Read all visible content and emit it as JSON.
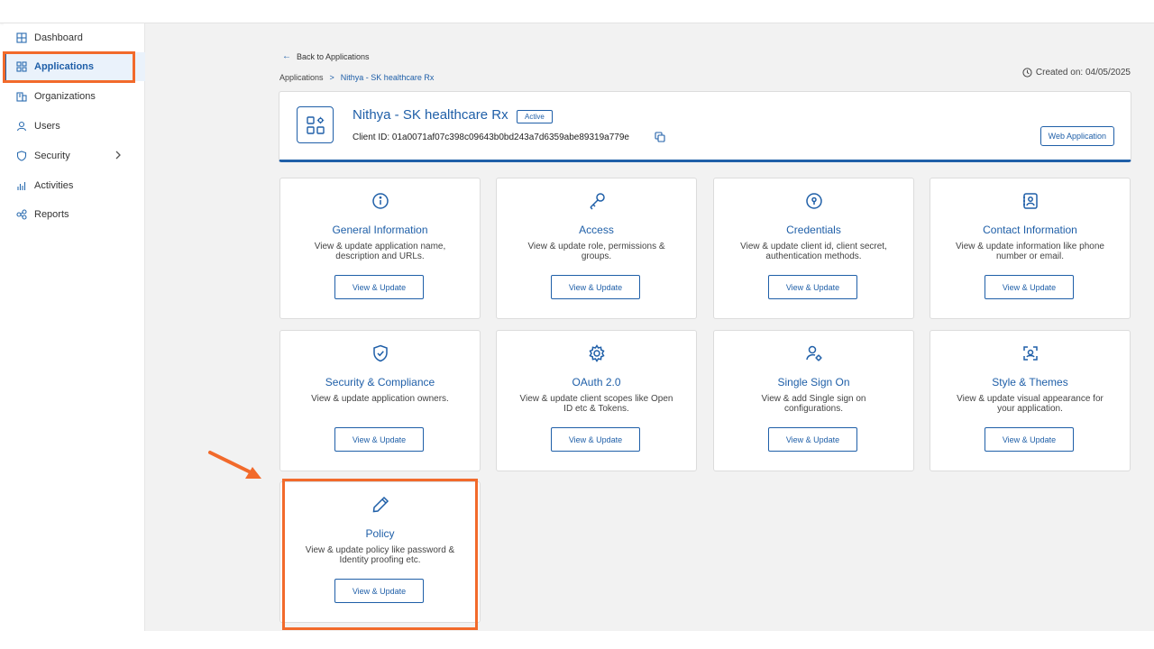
{
  "sidebar": {
    "items": [
      {
        "label": "Dashboard",
        "icon": "dashboard-icon"
      },
      {
        "label": "Applications",
        "icon": "applications-icon"
      },
      {
        "label": "Organizations",
        "icon": "organizations-icon"
      },
      {
        "label": "Users",
        "icon": "user-icon"
      },
      {
        "label": "Security",
        "icon": "shield-icon"
      },
      {
        "label": "Activities",
        "icon": "bar-chart-icon"
      },
      {
        "label": "Reports",
        "icon": "reports-icon"
      }
    ]
  },
  "nav": {
    "back_label": "Back to Applications",
    "breadcrumb_root": "Applications",
    "breadcrumb_sep": ">",
    "breadcrumb_current": "Nithya - SK healthcare Rx",
    "created": "Created on: 04/05/2025"
  },
  "app": {
    "name": "Nithya - SK healthcare Rx",
    "status": "Active",
    "client_id": "Client ID: 01a0071af07c398c09643b0bd243a7d6359abe89319a779e",
    "type_label": "Web Application"
  },
  "cards": [
    {
      "title": "General Information",
      "desc": "View & update application name, description and URLs.",
      "button": "View & Update",
      "icon": "info-icon"
    },
    {
      "title": "Access",
      "desc": "View & update role, permissions & groups.",
      "button": "View & Update",
      "icon": "key-icon"
    },
    {
      "title": "Credentials",
      "desc": "View & update client id, client secret, authentication methods.",
      "button": "View & Update",
      "icon": "lock-circle-icon"
    },
    {
      "title": "Contact Information",
      "desc": "View & update information like phone number or email.",
      "button": "View & Update",
      "icon": "contact-card-icon"
    },
    {
      "title": "Security & Compliance",
      "desc": "View & update application owners.",
      "button": "View & Update",
      "icon": "shield-check-icon"
    },
    {
      "title": "OAuth 2.0",
      "desc": "View & update client scopes like Open ID etc & Tokens.",
      "button": "View & Update",
      "icon": "gear-icon"
    },
    {
      "title": "Single Sign On",
      "desc": "View & add Single sign on configurations.",
      "button": "View & Update",
      "icon": "user-gear-icon"
    },
    {
      "title": "Style & Themes",
      "desc": "View & update visual appearance for your application.",
      "button": "View & Update",
      "icon": "palette-icon"
    },
    {
      "title": "Policy",
      "desc": "View & update policy like password & Identity proofing etc.",
      "button": "View & Update",
      "icon": "pencil-icon"
    }
  ],
  "colors": {
    "accent": "#1f5fa8",
    "annotation": "#f26a2b",
    "background": "#f2f2f2"
  }
}
